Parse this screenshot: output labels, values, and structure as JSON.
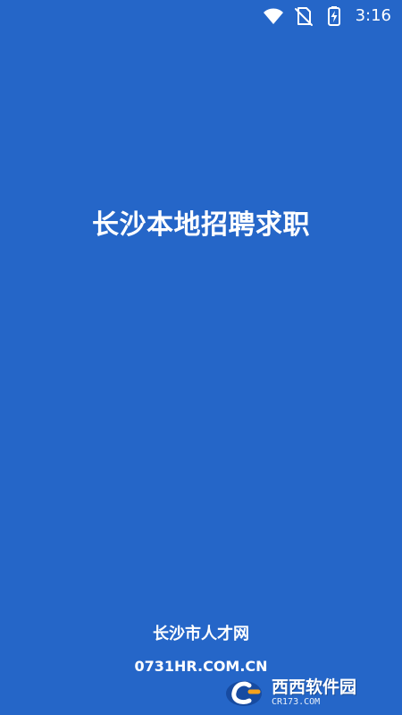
{
  "status_bar": {
    "time": "3:16",
    "icons": [
      "wifi-icon",
      "no-sim-icon",
      "battery-charging-icon"
    ]
  },
  "splash": {
    "title": "长沙本地招聘求职"
  },
  "footer": {
    "site_name": "长沙市人才网",
    "url": "0731HR.COM.CN"
  },
  "watermark": {
    "text": "西西软件园",
    "domain": "CR173.COM"
  },
  "colors": {
    "background": "#2566c8",
    "text": "#ffffff",
    "watermark_accent": "#f7a21b"
  }
}
